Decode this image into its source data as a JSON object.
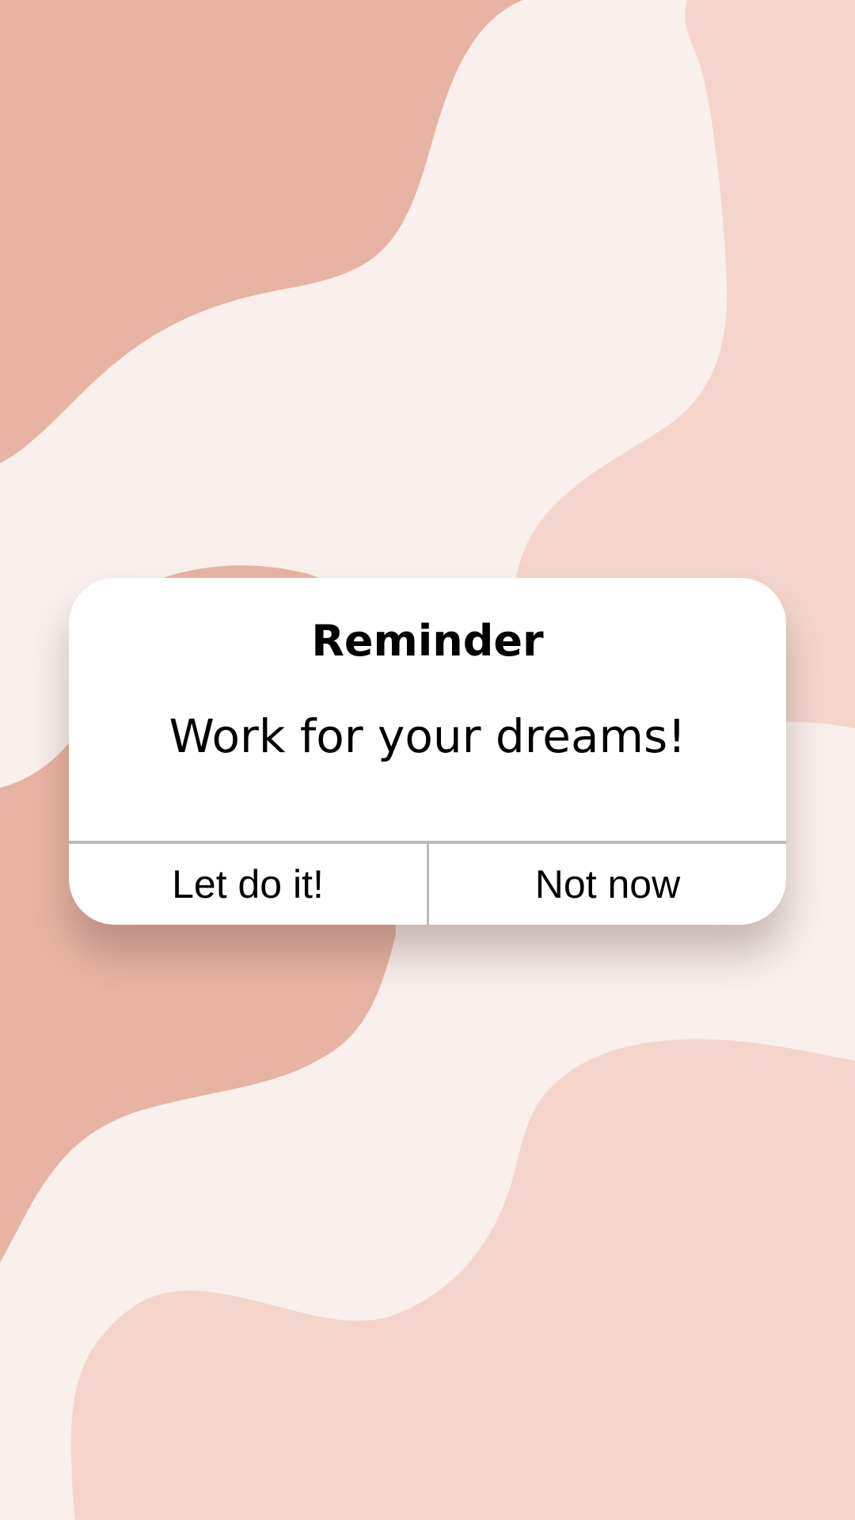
{
  "background": {
    "colors": {
      "base": "#f9efec",
      "dark": "#e8b3a3",
      "light": "#f4d5cb"
    }
  },
  "dialog": {
    "title": "Reminder",
    "message": "Work for your dreams!",
    "buttons": {
      "confirm_label": "Let do it!",
      "dismiss_label": "Not now"
    },
    "colors": {
      "surface": "#ffffff",
      "divider": "#bcb9b7",
      "text": "#000000"
    }
  }
}
